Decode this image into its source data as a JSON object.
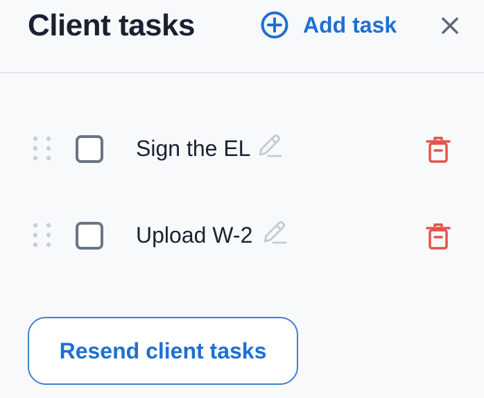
{
  "header": {
    "title": "Client tasks",
    "add_task_label": "Add task",
    "add_icon": "plus-circle-icon",
    "close_icon": "close-icon"
  },
  "tasks": [
    {
      "label": "Sign the EL",
      "checked": false
    },
    {
      "label": "Upload W-2",
      "checked": false
    }
  ],
  "footer": {
    "resend_label": "Resend client tasks"
  },
  "colors": {
    "accent": "#1f6fd1",
    "danger": "#e5534b",
    "text": "#1b2130",
    "muted_icon": "#c4cad3",
    "background": "#f8f9fb"
  }
}
